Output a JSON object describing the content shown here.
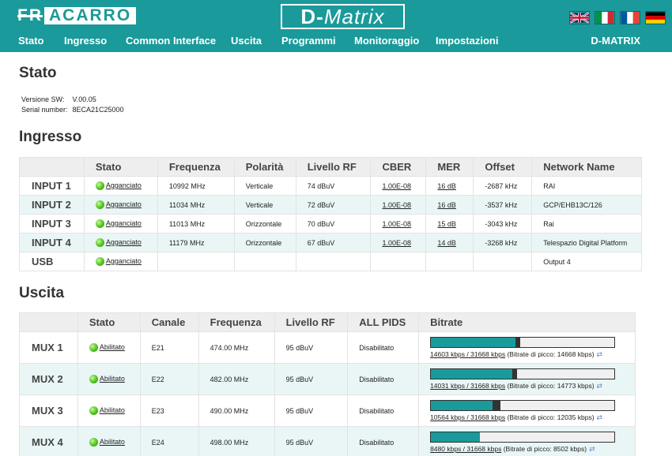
{
  "header": {
    "brand": "FRACARRO",
    "brand_part1": "FR",
    "brand_part2": "ACARRO",
    "product": "D-Matrix",
    "product_part1": "D-",
    "product_part2": "Matrix",
    "device_name": "D-MATRIX",
    "flags": [
      "flag-uk-icon",
      "flag-italy-icon",
      "flag-france-icon",
      "flag-germany-icon"
    ],
    "accent_color": "#1a9a9a"
  },
  "nav": {
    "items": [
      {
        "label": "Stato"
      },
      {
        "label": "Ingresso"
      },
      {
        "label": "Common Interface"
      },
      {
        "label": "Uscita"
      },
      {
        "label": "Programmi"
      },
      {
        "label": "Monitoraggio"
      },
      {
        "label": "Impostazioni"
      }
    ]
  },
  "stato": {
    "title": "Stato",
    "version_label": "Versione SW:",
    "version_value": "V.00.05",
    "serial_label": "Serial number:",
    "serial_value": "8ECA21C25000"
  },
  "ingresso": {
    "title": "Ingresso",
    "headers": [
      "",
      "Stato",
      "Frequenza",
      "Polarità",
      "Livello RF",
      "CBER",
      "MER",
      "Offset",
      "Network Name"
    ],
    "rows": [
      {
        "name": "INPUT 1",
        "stato": "Agganciato",
        "freq": "10992 MHz",
        "pol": "Verticale",
        "rf": "74 dBuV",
        "cber": "1.00E-08",
        "mer": "16 dB",
        "offset": "-2687 kHz",
        "network": "RAI"
      },
      {
        "name": "INPUT 2",
        "stato": "Agganciato",
        "freq": "11034 MHz",
        "pol": "Verticale",
        "rf": "72 dBuV",
        "cber": "1.00E-08",
        "mer": "16 dB",
        "offset": "-3537 kHz",
        "network": "GCP/EHB13C/126"
      },
      {
        "name": "INPUT 3",
        "stato": "Agganciato",
        "freq": "11013 MHz",
        "pol": "Orizzontale",
        "rf": "70 dBuV",
        "cber": "1.00E-08",
        "mer": "15 dB",
        "offset": "-3043 kHz",
        "network": "Rai"
      },
      {
        "name": "INPUT 4",
        "stato": "Agganciato",
        "freq": "11179 MHz",
        "pol": "Orizzontale",
        "rf": "67 dBuV",
        "cber": "1.00E-08",
        "mer": "14 dB",
        "offset": "-3268 kHz",
        "network": "Telespazio Digital Platform"
      },
      {
        "name": "USB",
        "stato": "Agganciato",
        "freq": "",
        "pol": "",
        "rf": "",
        "cber": "",
        "mer": "",
        "offset": "",
        "network": "Output 4"
      }
    ]
  },
  "uscita": {
    "title": "Uscita",
    "headers": [
      "",
      "Stato",
      "Canale",
      "Frequenza",
      "Livello RF",
      "ALL PIDS",
      "Bitrate"
    ],
    "rows": [
      {
        "name": "MUX 1",
        "stato": "Abilitato",
        "canale": "E21",
        "freq": "474.00 MHz",
        "rf": "95 dBuV",
        "pids": "Disabilitato",
        "bitrate_link": "14603 kbps / 31668 kbps",
        "bitrate_peak": "(Bitrate di picco: 14668 kbps)",
        "fill": 0.461,
        "peak": 0.463
      },
      {
        "name": "MUX 2",
        "stato": "Abilitato",
        "canale": "E22",
        "freq": "482.00 MHz",
        "rf": "95 dBuV",
        "pids": "Disabilitato",
        "bitrate_link": "14031 kbps / 31668 kbps",
        "bitrate_peak": "(Bitrate di picco: 14773 kbps)",
        "fill": 0.443,
        "peak": 0.466
      },
      {
        "name": "MUX 3",
        "stato": "Abilitato",
        "canale": "E23",
        "freq": "490.00 MHz",
        "rf": "95 dBuV",
        "pids": "Disabilitato",
        "bitrate_link": "10564 kbps / 31668 kbps",
        "bitrate_peak": "(Bitrate di picco: 12035 kbps)",
        "fill": 0.334,
        "peak": 0.38
      },
      {
        "name": "MUX 4",
        "stato": "Abilitato",
        "canale": "E24",
        "freq": "498.00 MHz",
        "rf": "95 dBuV",
        "pids": "Disabilitato",
        "bitrate_link": "8480 kbps / 31668 kbps",
        "bitrate_peak": "(Bitrate di picco: 8502 kbps)",
        "fill": 0.268,
        "peak": 0.268
      }
    ]
  }
}
